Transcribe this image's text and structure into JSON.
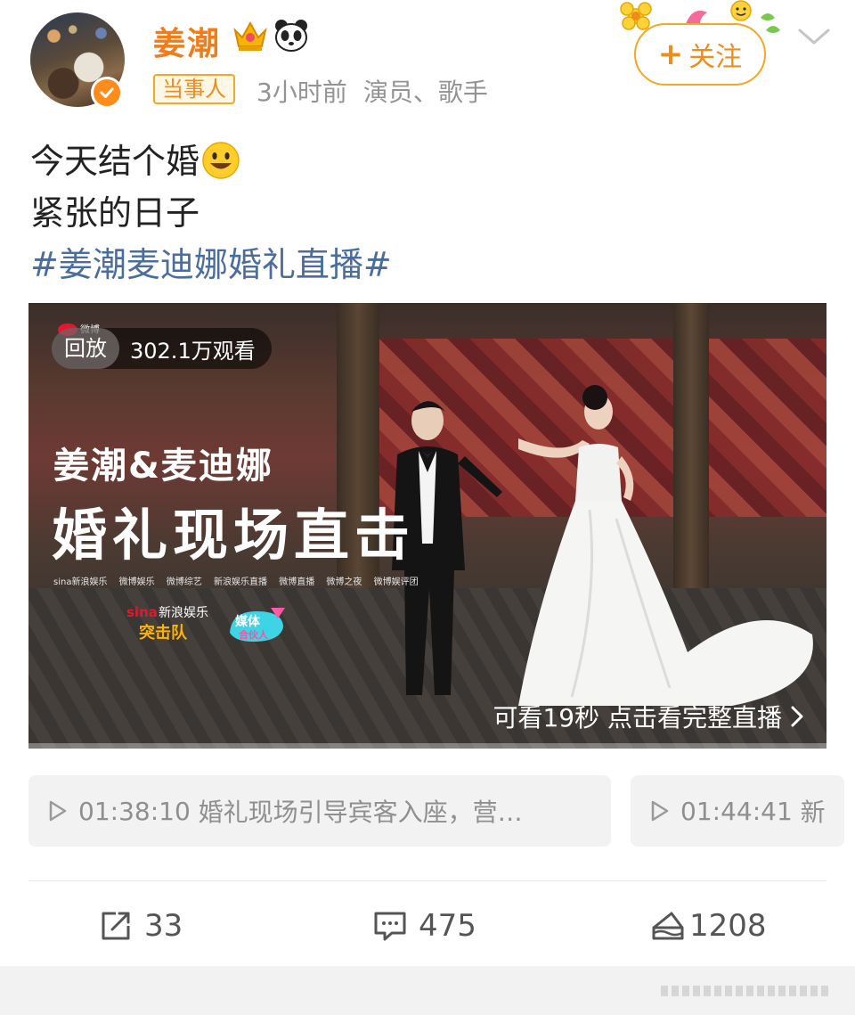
{
  "post": {
    "author": "姜潮",
    "tag": "当事人",
    "time": "3小时前",
    "category": "演员、歌手",
    "follow_label": "关注",
    "text_line1": "今天结个婚",
    "text_line2": "紧张的日子",
    "hashtag": "#姜潮麦迪娜婚礼直播#"
  },
  "video": {
    "replay_label": "回放",
    "views": "302.1万观看",
    "overlay_title1": "姜潮&麦迪娜",
    "overlay_title2": "婚礼现场直击",
    "sponsors": [
      "sina新浪娱乐",
      "微博娱乐",
      "微博综艺",
      "新浪娱乐直播",
      "微博直播",
      "微博之夜",
      "微博娱评团"
    ],
    "sina_logo_text": "sina新浪娱乐 突击队",
    "media_logo_text": "媒体 合伙人",
    "watch_full": "可看19秒 点击看完整直播",
    "progress": 0
  },
  "chapters": [
    {
      "time": "01:38:10",
      "text": "婚礼现场引导宾客入座，营…"
    },
    {
      "time": "01:44:41",
      "text": "新"
    }
  ],
  "actions": {
    "repost_count": "33",
    "comment_count": "475",
    "like_count": "1208"
  },
  "colors": {
    "accent": "#f08c1a",
    "hashtag": "#4a6d9c",
    "muted": "#939393"
  },
  "icons": {
    "verified": "verified-badge-icon",
    "crown": "crown-icon",
    "panda": "panda-icon",
    "chevron": "chevron-down-icon",
    "play": "play-icon",
    "repost": "repost-icon",
    "comment": "comment-icon",
    "like": "like-cake-icon"
  }
}
